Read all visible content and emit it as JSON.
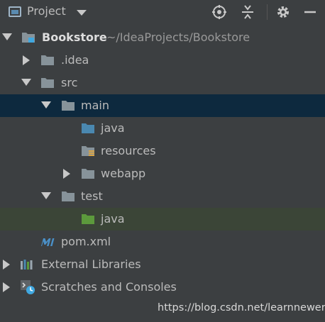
{
  "header": {
    "title": "Project",
    "icons": [
      "project-view-icon",
      "dropdown-caret-icon",
      "locate-target-icon",
      "collapse-all-icon",
      "gear-icon",
      "minimize-icon"
    ]
  },
  "colors": {
    "background": "#3c3f41",
    "selected_row": "#0d293e",
    "highlight_row": "#3b4537",
    "folder_gray": "#87939a",
    "folder_blue": "#4a88b0",
    "folder_green": "#5c9a3c",
    "maven_blue": "#4a90c8"
  },
  "tree": {
    "root_name": "Bookstore",
    "root_path": "~/IdeaProjects/Bookstore",
    "idea": ".idea",
    "src": "src",
    "main": "main",
    "main_java": "java",
    "resources": "resources",
    "webapp": "webapp",
    "test": "test",
    "test_java": "java",
    "pom": "pom.xml",
    "external_libraries": "External Libraries",
    "scratches": "Scratches and Consoles"
  },
  "watermark": "https://blog.csdn.net/learnnewer"
}
